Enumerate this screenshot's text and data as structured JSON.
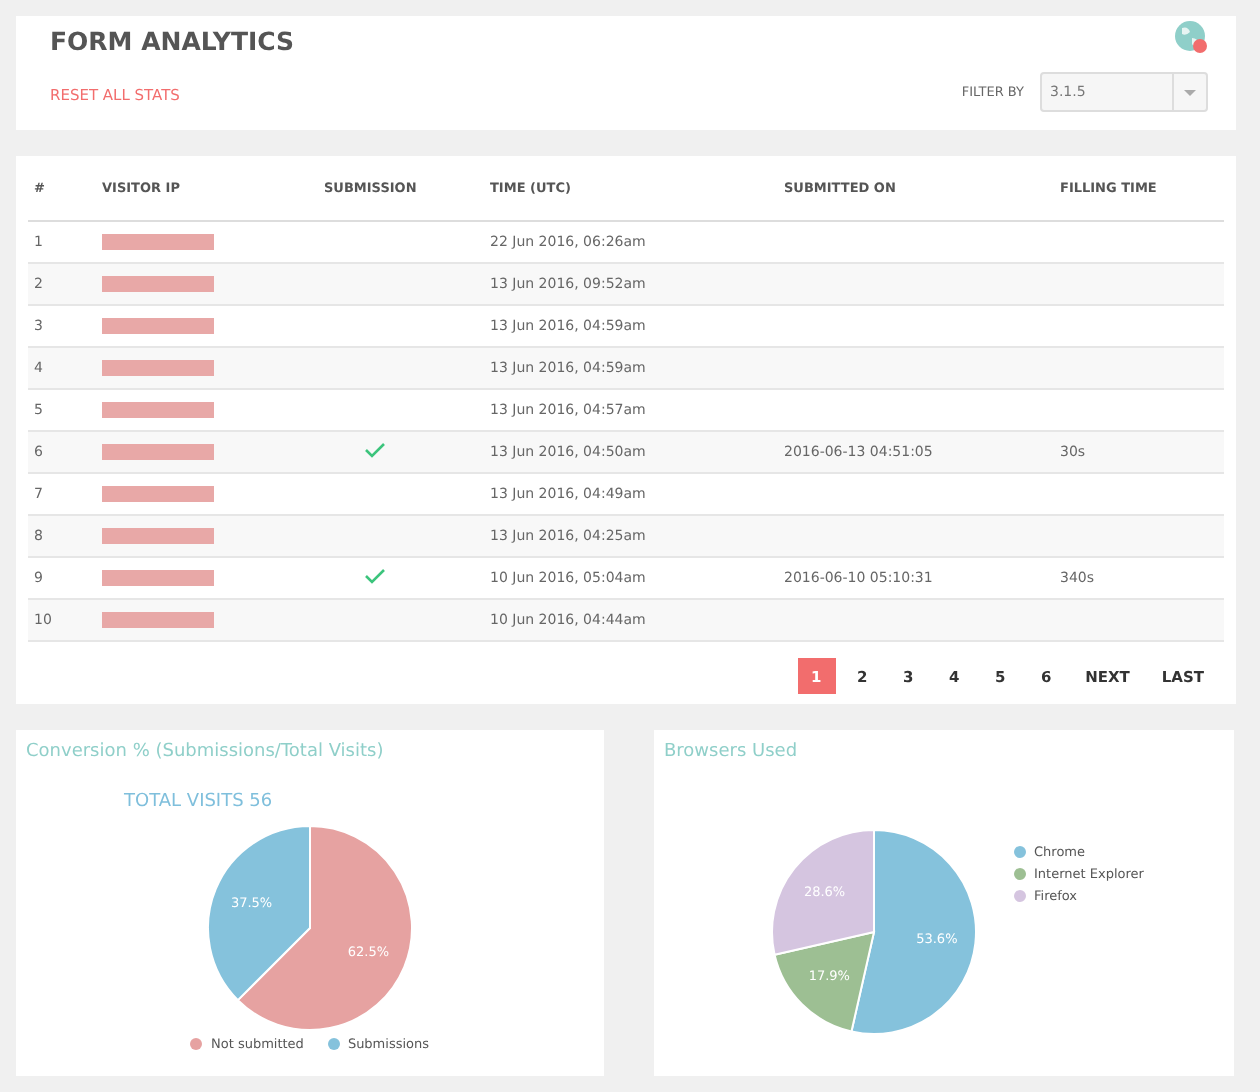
{
  "header": {
    "title": "FORM ANALYTICS",
    "reset_link": "RESET ALL STATS",
    "filter": {
      "label": "FILTER BY",
      "value": "3.1.5"
    }
  },
  "table": {
    "columns": [
      "#",
      "VISITOR IP",
      "SUBMISSION",
      "TIME (UTC)",
      "SUBMITTED ON",
      "FILLING TIME"
    ],
    "rows": [
      {
        "index": "1",
        "submitted": false,
        "time": "22 Jun 2016, 06:26am"
      },
      {
        "index": "2",
        "submitted": false,
        "time": "13 Jun 2016, 09:52am"
      },
      {
        "index": "3",
        "submitted": false,
        "time": "13 Jun 2016, 04:59am"
      },
      {
        "index": "4",
        "submitted": false,
        "time": "13 Jun 2016, 04:59am"
      },
      {
        "index": "5",
        "submitted": false,
        "time": "13 Jun 2016, 04:57am"
      },
      {
        "index": "6",
        "submitted": true,
        "time": "13 Jun 2016, 04:50am",
        "submitted_on": "2016-06-13 04:51:05",
        "filling_time": "30s"
      },
      {
        "index": "7",
        "submitted": false,
        "time": "13 Jun 2016, 04:49am"
      },
      {
        "index": "8",
        "submitted": false,
        "time": "13 Jun 2016, 04:25am"
      },
      {
        "index": "9",
        "submitted": true,
        "time": "10 Jun 2016, 05:04am",
        "submitted_on": "2016-06-10 05:10:31",
        "filling_time": "340s"
      },
      {
        "index": "10",
        "submitted": false,
        "time": "10 Jun 2016, 04:44am"
      }
    ]
  },
  "pagination": {
    "pages": [
      {
        "label": "1",
        "selected": true
      },
      {
        "label": "2",
        "selected": false
      },
      {
        "label": "3",
        "selected": false
      },
      {
        "label": "4",
        "selected": false
      },
      {
        "label": "5",
        "selected": false
      },
      {
        "label": "6",
        "selected": false
      }
    ],
    "next": "NEXT",
    "last": "LAST"
  },
  "conversion": {
    "title": "Conversion % (Submissions/Total Visits)",
    "total": "TOTAL VISITS 56",
    "chart_data": {
      "type": "pie",
      "categories": [
        "Not submitted",
        "Submissions"
      ],
      "values": [
        62.5,
        37.5
      ],
      "colors": [
        "#e6a2a1",
        "#85c2dc"
      ],
      "value_labels": [
        "62.5%",
        "37.5%"
      ]
    }
  },
  "browsers": {
    "title": "Browsers Used",
    "chart_data": {
      "type": "pie",
      "categories": [
        "Chrome",
        "Internet Explorer",
        "Firefox"
      ],
      "values": [
        53.6,
        17.9,
        28.6
      ],
      "colors": [
        "#85c2dc",
        "#9dbf93",
        "#d5c5e0"
      ],
      "value_labels": [
        "53.6%",
        "17.9%",
        "28.6%"
      ]
    }
  }
}
